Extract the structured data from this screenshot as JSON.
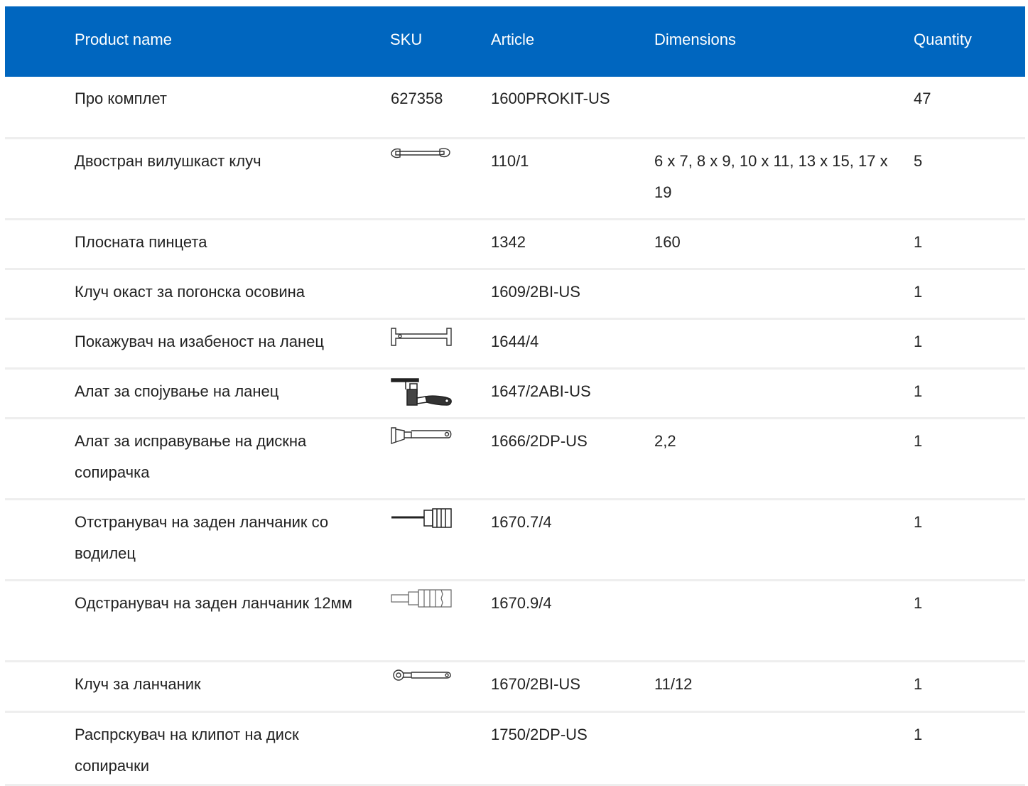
{
  "header": {
    "product_name": "Product name",
    "sku": "SKU",
    "article": "Article",
    "dimensions": "Dimensions",
    "quantity": "Quantity"
  },
  "rows": [
    {
      "name": "Про комплет",
      "sku": "627358",
      "sku_icon": "",
      "article": "1600PROKIT-US",
      "dimensions": "",
      "quantity": "47"
    },
    {
      "name": "Двостран вилушкаст клуч",
      "sku": "",
      "sku_icon": "open-end-wrench-icon",
      "article": "110/1",
      "dimensions": "6 x 7, 8 x 9, 10 x 11, 13 x 15, 17 x 19",
      "quantity": "5"
    },
    {
      "name": "Плосната пинцета",
      "sku": "",
      "sku_icon": "",
      "article": "1342",
      "dimensions": "160",
      "quantity": "1"
    },
    {
      "name": "Клуч окаст за погонска осовина",
      "sku": "",
      "sku_icon": "",
      "article": "1609/2BI-US",
      "dimensions": "",
      "quantity": "1"
    },
    {
      "name": "Покажувач на изабеност на ланец",
      "sku": "",
      "sku_icon": "chain-checker-icon",
      "article": "1644/4",
      "dimensions": "",
      "quantity": "1"
    },
    {
      "name": "Алат за спојување на ланец",
      "sku": "",
      "sku_icon": "chain-tool-icon",
      "article": "1647/2ABI-US",
      "dimensions": "",
      "quantity": "1"
    },
    {
      "name": "Алат за исправување на дискна сопирачка",
      "sku": "",
      "sku_icon": "rotor-truing-tool-icon",
      "article": "1666/2DP-US",
      "dimensions": "2,2",
      "quantity": "1"
    },
    {
      "name": "Отстранувач на заден ланчаник со водилец",
      "sku": "",
      "sku_icon": "cassette-remover-guide-icon",
      "article": "1670.7/4",
      "dimensions": "",
      "quantity": "1"
    },
    {
      "name": "Одстранувач на заден ланчаник 12мм",
      "sku": "",
      "sku_icon": "cassette-remover-icon",
      "article": "1670.9/4",
      "dimensions": "",
      "quantity": "1"
    },
    {
      "name": "Клуч за ланчаник",
      "sku": "",
      "sku_icon": "chain-whip-icon",
      "article": "1670/2BI-US",
      "dimensions": "11/12",
      "quantity": "1"
    },
    {
      "name": "Распрскувач на клипот на диск сопирачки",
      "sku": "",
      "sku_icon": "",
      "article": "1750/2DP-US",
      "dimensions": "",
      "quantity": "1"
    }
  ],
  "colors": {
    "header_bg": "#0066bf",
    "header_text": "#ffffff",
    "row_divider": "#eeeeee",
    "body_text": "#222222"
  }
}
